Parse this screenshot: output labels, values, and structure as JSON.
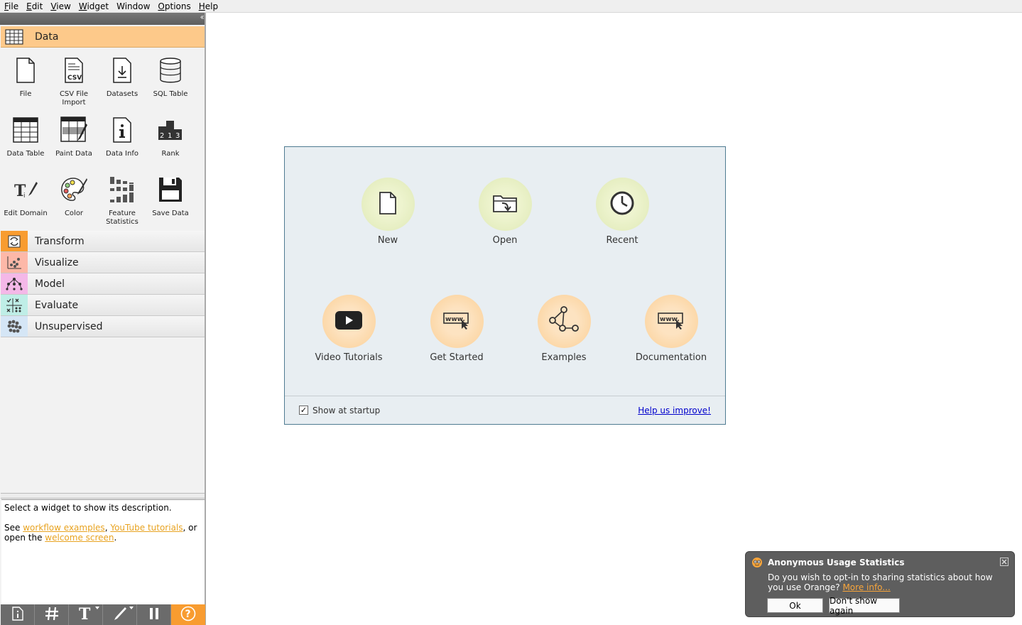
{
  "menubar": {
    "items": [
      {
        "mnemonic": "F",
        "rest": "ile"
      },
      {
        "mnemonic": "E",
        "rest": "dit"
      },
      {
        "mnemonic": "V",
        "rest": "iew"
      },
      {
        "mnemonic": "W",
        "rest": "idget"
      },
      {
        "mnemonic": "",
        "rest": "Window"
      },
      {
        "mnemonic": "O",
        "rest": "ptions"
      },
      {
        "mnemonic": "H",
        "rest": "elp"
      }
    ]
  },
  "toolbox": {
    "categories": [
      {
        "label": "Data",
        "icon": "data-table-icon",
        "color": "#fdc98a",
        "expanded": true
      },
      {
        "label": "Transform",
        "icon": "transform-icon",
        "color": "#f89c30"
      },
      {
        "label": "Visualize",
        "icon": "visualize-icon",
        "color": "#fdb8a8"
      },
      {
        "label": "Model",
        "icon": "model-icon",
        "color": "#f4b8e8"
      },
      {
        "label": "Evaluate",
        "icon": "evaluate-icon",
        "color": "#bfeee7"
      },
      {
        "label": "Unsupervised",
        "icon": "unsupervised-icon",
        "color": "#d5e6f6"
      }
    ],
    "data_widgets": [
      {
        "label": "File",
        "icon": "file-icon"
      },
      {
        "label": "CSV File Import",
        "icon": "csv-icon"
      },
      {
        "label": "Datasets",
        "icon": "datasets-icon"
      },
      {
        "label": "SQL Table",
        "icon": "database-icon"
      },
      {
        "label": "Data Table",
        "icon": "table-icon"
      },
      {
        "label": "Paint Data",
        "icon": "paint-icon"
      },
      {
        "label": "Data Info",
        "icon": "info-icon"
      },
      {
        "label": "Rank",
        "icon": "podium-icon"
      },
      {
        "label": "Edit Domain",
        "icon": "edit-domain-icon"
      },
      {
        "label": "Color",
        "icon": "palette-icon"
      },
      {
        "label": "Feature Statistics",
        "icon": "feature-stats-icon"
      },
      {
        "label": "Save Data",
        "icon": "floppy-icon"
      }
    ]
  },
  "description": {
    "line1": "Select a widget to show its description.",
    "see": "See ",
    "link1": "workflow examples",
    "comma": ", ",
    "link2": "YouTube tutorials",
    "mid": ", or open the ",
    "link3": "welcome screen",
    "end": "."
  },
  "welcome": {
    "buttons_top": [
      {
        "label": "New",
        "icon": "new-document-icon"
      },
      {
        "label": "Open",
        "icon": "open-folder-icon"
      },
      {
        "label": "Recent",
        "icon": "clock-icon"
      }
    ],
    "buttons_bottom": [
      {
        "label": "Video Tutorials",
        "icon": "play-icon"
      },
      {
        "label": "Get Started",
        "icon": "www-icon"
      },
      {
        "label": "Examples",
        "icon": "network-icon"
      },
      {
        "label": "Documentation",
        "icon": "www-icon"
      }
    ],
    "show_at_startup": "Show at startup",
    "show_at_startup_checked": true,
    "help_link": "Help us improve!"
  },
  "notification": {
    "title": "Anonymous Usage Statistics",
    "text": "Do you wish to opt-in to sharing statistics about how you use Orange?",
    "link": "More info...",
    "ok": "Ok",
    "dont_show": "Don't show again"
  },
  "colors": {
    "accent_orange": "#f89c30",
    "data_header": "#fdc98a",
    "link_orange": "#e8a321"
  }
}
